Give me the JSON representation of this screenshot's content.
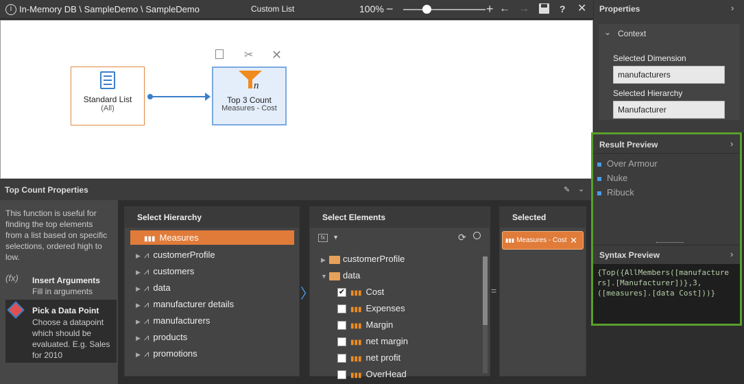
{
  "topbar": {
    "breadcrumb": "In-Memory DB \\ SampleDemo \\ SampleDemo",
    "title": "Custom List",
    "zoom": "100%"
  },
  "canvas": {
    "node1": {
      "title": "Standard List",
      "subtitle": "(All)"
    },
    "node2": {
      "title": "Top 3 Count",
      "subtitle": "Measures - Cost"
    }
  },
  "bottom": {
    "title": "Top Count Properties",
    "description": "This function is useful for finding the top elements from a list based on specific selections, ordered high to low.",
    "insert_args": {
      "title": "Insert Arguments",
      "subtitle": "Fill in arguments"
    },
    "pick_point": {
      "title": "Pick a Data Point",
      "subtitle": "Choose a datapoint which should be evaluated. E.g. Sales for 2010"
    }
  },
  "hierarchy": {
    "title": "Select Hierarchy",
    "items": [
      "Measures",
      "customerProfile",
      "customers",
      "data",
      "manufacturer details",
      "manufacturers",
      "products",
      "promotions"
    ]
  },
  "elements": {
    "title": "Select Elements",
    "folders": [
      "customerProfile",
      "data"
    ],
    "items": [
      {
        "label": "Cost",
        "checked": true
      },
      {
        "label": "Expenses",
        "checked": false
      },
      {
        "label": "Margin",
        "checked": false
      },
      {
        "label": "net margin",
        "checked": false
      },
      {
        "label": "net profit",
        "checked": false
      },
      {
        "label": "OverHead",
        "checked": false
      }
    ]
  },
  "selected": {
    "title": "Selected",
    "chip": "Measures - Cost"
  },
  "properties": {
    "title": "Properties",
    "context": "Context",
    "dim_label": "Selected Dimension",
    "dim_value": "manufacturers",
    "hier_label": "Selected Hierarchy",
    "hier_value": "Manufacturer"
  },
  "result_preview": {
    "title": "Result Preview",
    "items": [
      "Over Armour",
      "Nuke",
      "Ribuck"
    ]
  },
  "syntax_preview": {
    "title": "Syntax Preview",
    "code_parts": [
      "{Top({AllMembers([manufacture",
      "rs].[Manufacturer])},3,",
      "([measures].[data Cost]))}"
    ]
  },
  "colors": {
    "accent": "#f08c1e",
    "highlight": "#5aa02c",
    "selected": "#e07b39"
  }
}
